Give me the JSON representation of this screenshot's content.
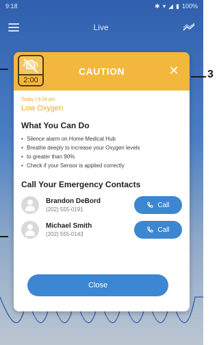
{
  "statusbar": {
    "time": "9:18",
    "battery": "100%"
  },
  "appbar": {
    "title": "Live"
  },
  "modal": {
    "header_title": "CAUTION",
    "timer": "2:00",
    "timestamp": "Today | 9:24 pm",
    "alert_title": "Low Oxygen",
    "what_you_can_do": {
      "title": "What You Can Do",
      "bullets": [
        "Silence alarm on Home Medical Hub",
        "Breathe deeply to increase your Oxygen levels",
        "to greater than 90%",
        "Check if your Sensor is applied correctly"
      ]
    },
    "contacts": {
      "title": "Call Your Emergency Contacts",
      "items": [
        {
          "name": "Brandon DeBord",
          "phone": "(202) 555-0191",
          "button": "Call"
        },
        {
          "name": "Michael Smith",
          "phone": "(202) 555-0143",
          "button": "Call"
        }
      ]
    },
    "close_label": "Close"
  },
  "callout": {
    "number": "3"
  },
  "colors": {
    "accent_blue": "#3c86d2",
    "caution_orange": "#f3b73d",
    "text_orange": "#f0a628"
  },
  "icons": {
    "menu": "menu-icon",
    "trend": "trend-icon",
    "alarm": "alarm-silence-icon",
    "close": "close-icon",
    "phone": "phone-icon",
    "avatar": "avatar-icon"
  }
}
